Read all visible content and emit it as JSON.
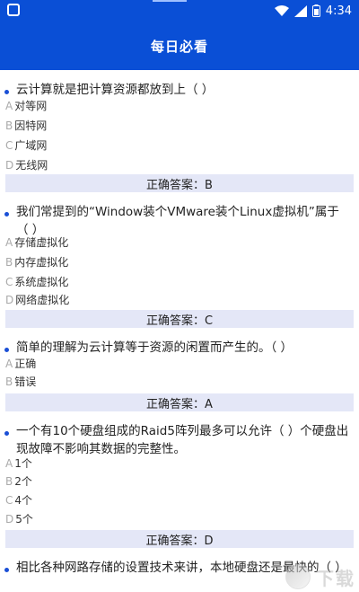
{
  "status_bar": {
    "time": "4:34"
  },
  "app_bar": {
    "title": "每日必看"
  },
  "questions": [
    {
      "text": "云计算就是把计算资源都放到上（ ）",
      "options": [
        {
          "letter": "A",
          "text": "对等网"
        },
        {
          "letter": "B",
          "text": "因特网"
        },
        {
          "letter": "C",
          "text": "广域网"
        },
        {
          "letter": "D",
          "text": "无线网"
        }
      ],
      "answer": "正确答案：B"
    },
    {
      "text": "我们常提到的“Window装个VMware装个Linux虚拟机”属于（ ）",
      "options": [
        {
          "letter": "A",
          "text": "存储虚拟化"
        },
        {
          "letter": "B",
          "text": "内存虚拟化"
        },
        {
          "letter": "C",
          "text": "系统虚拟化"
        },
        {
          "letter": "D",
          "text": "网络虚拟化"
        }
      ],
      "answer": "正确答案：C"
    },
    {
      "text": "简单的理解为云计算等于资源的闲置而产生的。（ ）",
      "options": [
        {
          "letter": "A",
          "text": "正确"
        },
        {
          "letter": "B",
          "text": "错误"
        }
      ],
      "answer": "正确答案：A"
    },
    {
      "text": "一个有10个硬盘组成的Raid5阵列最多可以允许（ ）个硬盘出现故障不影响其数据的完整性。",
      "options": [
        {
          "letter": "A",
          "text": "1个"
        },
        {
          "letter": "B",
          "text": "2个"
        },
        {
          "letter": "C",
          "text": "4个"
        },
        {
          "letter": "D",
          "text": "5个"
        }
      ],
      "answer": "正确答案：D"
    },
    {
      "text": "相比各种网路存储的设置技术来讲，本地硬盘还是最快的（ ）",
      "options": [],
      "answer": ""
    }
  ],
  "watermark": {
    "text": "下载"
  }
}
